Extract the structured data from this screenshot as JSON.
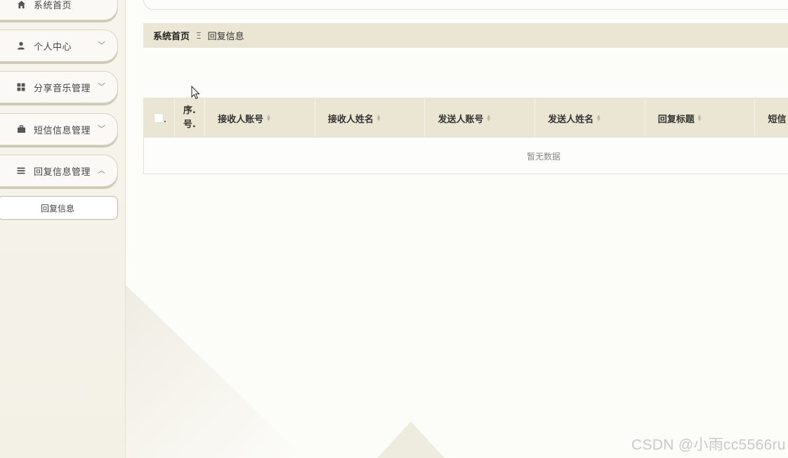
{
  "sidebar": {
    "items": [
      {
        "label": "系统首页",
        "icon": "home-icon"
      },
      {
        "label": "个人中心",
        "icon": "user-icon",
        "chevron": "﹀"
      },
      {
        "label": "分享音乐管理",
        "icon": "grid-icon",
        "chevron": "﹀"
      },
      {
        "label": "短信信息管理",
        "icon": "briefcase-icon",
        "chevron": "﹀"
      },
      {
        "label": "回复信息管理",
        "icon": "list-icon",
        "chevron": "︿"
      }
    ],
    "sub_item": "回复信息"
  },
  "breadcrumb": {
    "home": "系统首页",
    "separator": "Ξ",
    "current": "回复信息"
  },
  "table": {
    "index_header": "序.\n号.",
    "columns": [
      "接收人账号",
      "接收人姓名",
      "发送人账号",
      "发送人姓名",
      "回复标题",
      "短信"
    ],
    "empty_text": "暂无数据"
  },
  "watermark": "CSDN @小雨cc5566ru",
  "colors": {
    "header_bg": "#ebe6d3",
    "sidebar_bg": "#f4f2e8",
    "page_bg": "#fcfcf9"
  }
}
